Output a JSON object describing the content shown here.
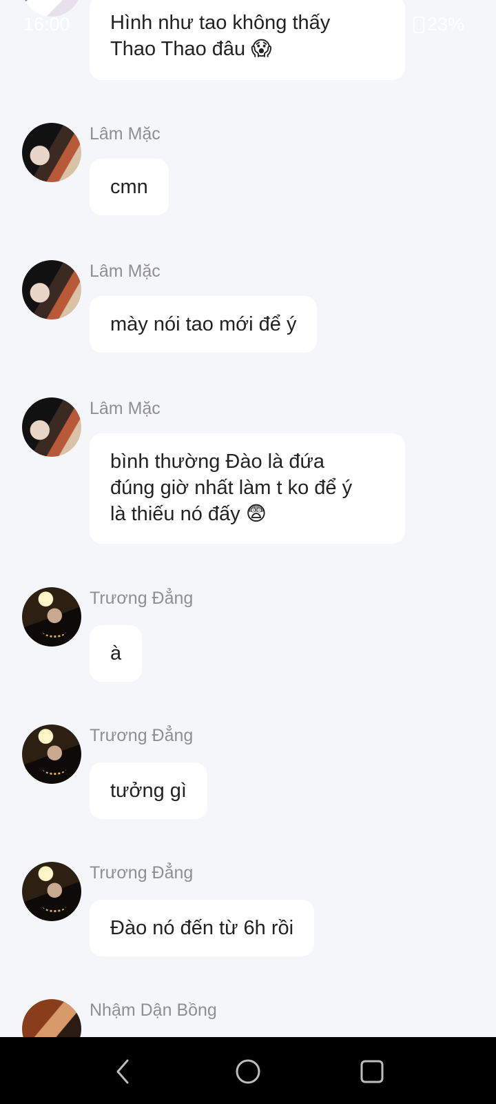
{
  "status_bar": {
    "time": "16:00",
    "battery": "23%"
  },
  "messages": [
    {
      "sender": "",
      "avatar": "top-avatar",
      "text": "Hình như tao không thấy\nThao Thao đâu 😱"
    },
    {
      "sender": "Lâm Mặc",
      "text": "cmn"
    },
    {
      "sender": "Lâm Mặc",
      "text": "mày nói tao mới để ý"
    },
    {
      "sender": "Lâm Mặc",
      "text": "bình thường Đào là đứa\nđúng giờ nhất làm t ko để ý\nlà thiếu nó đấy 😨"
    },
    {
      "sender": "Trương Đẳng",
      "text": "à"
    },
    {
      "sender": "Trương Đẳng",
      "text": "tưởng gì"
    },
    {
      "sender": "Trương Đẳng",
      "text": "Đào nó đến từ 6h rồi"
    },
    {
      "sender": "Nhậm Dận Bồng",
      "text": ""
    }
  ],
  "nav_bar": {
    "back_icon": "back-icon",
    "home_icon": "home-icon",
    "recents_icon": "recents-icon"
  }
}
